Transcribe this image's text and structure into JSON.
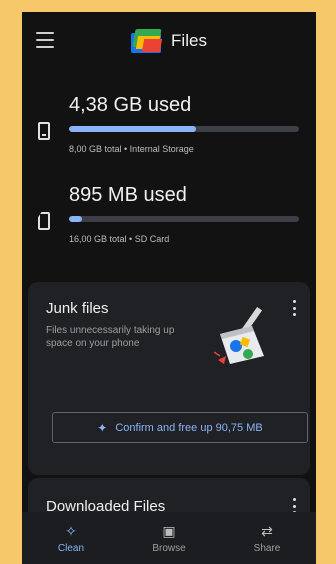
{
  "app": {
    "title": "Files",
    "menu_icon": "hamburger-menu-icon",
    "logo_icon": "files-logo-icon"
  },
  "storage": [
    {
      "used": "4,38 GB used",
      "total": "8,00 GB total • Internal Storage",
      "fill_fraction": 0.55,
      "icon": "phone-icon"
    },
    {
      "used": "895 MB used",
      "total": "16,00 GB total • SD Card",
      "fill_fraction": 0.055,
      "icon": "sd-card-icon"
    }
  ],
  "junk_card": {
    "title": "Junk files",
    "description": "Files unnecessarily taking up space on your phone",
    "button_label": "Confirm and free up 90,75 MB",
    "menu_icon": "more-vert-icon",
    "illustration": "broom-cleaning-illustration"
  },
  "downloaded_card": {
    "title": "Downloaded Files",
    "menu_icon": "more-vert-icon"
  },
  "bottom_nav": [
    {
      "label": "Clean",
      "icon": "sparkle-icon",
      "active": true
    },
    {
      "label": "Browse",
      "icon": "browse-icon",
      "active": false
    },
    {
      "label": "Share",
      "icon": "swap-arrows-icon",
      "active": false
    }
  ],
  "colors": {
    "accent": "#8ab4f8",
    "background": "#121212",
    "card": "#202124",
    "frame": "#f6c86a"
  }
}
